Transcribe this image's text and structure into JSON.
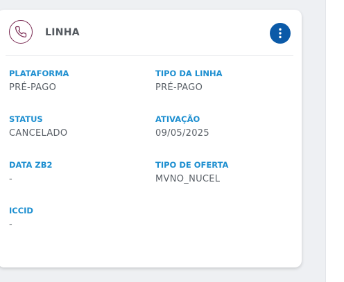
{
  "card": {
    "title": "LINHA",
    "header_icon": "phone-icon",
    "menu_icon": "more-vertical-icon"
  },
  "fields": {
    "plataforma": {
      "label": "PLATAFORMA",
      "value": "PRÉ-PAGO"
    },
    "tipo_linha": {
      "label": "TIPO DA LINHA",
      "value": "PRÉ-PAGO"
    },
    "status": {
      "label": "STATUS",
      "value": "CANCELADO"
    },
    "ativacao": {
      "label": "ATIVAÇÃO",
      "value": "09/05/2025"
    },
    "data_zb2": {
      "label": "DATA ZB2",
      "value": "-"
    },
    "tipo_oferta": {
      "label": "TIPO DE OFERTA",
      "value": "MVNO_NUCEL"
    },
    "iccid": {
      "label": "ICCID",
      "value": "-"
    }
  },
  "colors": {
    "accent_label": "#1e8fd0",
    "menu_button": "#0b5aa8",
    "icon_stroke": "#7a2a52"
  }
}
